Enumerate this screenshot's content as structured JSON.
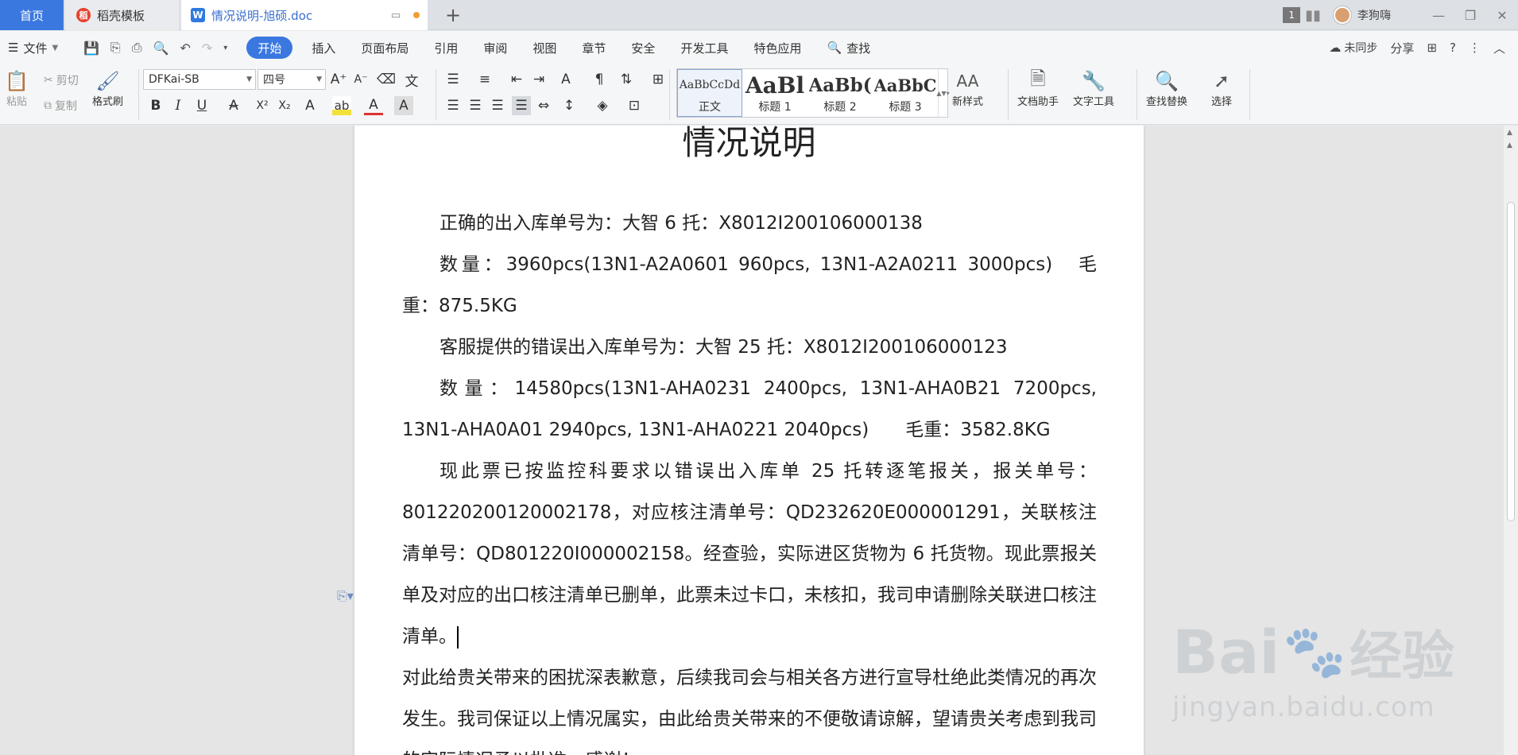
{
  "tabs": {
    "home": "首页",
    "template": "稻壳模板",
    "document": "情况说明-旭硕.doc",
    "new_tab": "+"
  },
  "window": {
    "count": "1",
    "user": "李狗嗨"
  },
  "menu": {
    "file": "文件",
    "tabs": [
      "开始",
      "插入",
      "页面布局",
      "引用",
      "审阅",
      "视图",
      "章节",
      "安全",
      "开发工具",
      "特色应用"
    ],
    "search": "查找",
    "sync": "未同步",
    "share": "分享"
  },
  "ribbon": {
    "paste": "粘贴",
    "cut": "剪切",
    "copy": "复制",
    "format_painter": "格式刷",
    "font_name": "DFKai-SB",
    "font_size": "四号",
    "styles": [
      {
        "preview": "AaBbCcDd",
        "name": "正文"
      },
      {
        "preview": "AaBl",
        "name": "标题 1"
      },
      {
        "preview": "AaBb(",
        "name": "标题 2"
      },
      {
        "preview": "AaBbC",
        "name": "标题 3"
      }
    ],
    "new_style": "新样式",
    "doc_assistant": "文档助手",
    "text_tools": "文字工具",
    "find_replace": "查找替换",
    "select": "选择"
  },
  "document": {
    "title": "情况说明",
    "paragraphs": [
      "正确的出入库单号为：大智 6 托：X8012I200106000138",
      "数量：3960pcs(13N1-A2A0601 960pcs, 13N1-A2A0211 3000pcs)　毛重：875.5KG",
      "客服提供的错误出入库单号为：大智 25 托：X8012I200106000123",
      "数量：14580pcs(13N1-AHA0231 2400pcs, 13N1-AHA0B21 7200pcs, 13N1-AHA0A01 2940pcs, 13N1-AHA0221 2040pcs)　　毛重：3582.8KG",
      "现此票已按监控科要求以错误出入库单 25 托转逐笔报关，报关单号：801220200120002178，对应核注清单号：QD232620E000001291，关联核注清单号：QD801220I000002158。经查验，实际进区货物为 6 托货物。现此票报关单及对应的出口核注清单已删单，此票未过卡口，未核扣，我司申请删除关联进口核注清单。",
      "对此给贵关带来的困扰深表歉意，后续我司会与相关各方进行宣导杜绝此类情况的再次发生。我司保证以上情况属实，由此给贵关带来的不便敬请谅解，望请贵关考虑到我司的实际情况予以批准，感谢！"
    ]
  },
  "watermark": {
    "brand": "Bai",
    "brand_cn": "经验",
    "url": "jingyan.baidu.com"
  }
}
